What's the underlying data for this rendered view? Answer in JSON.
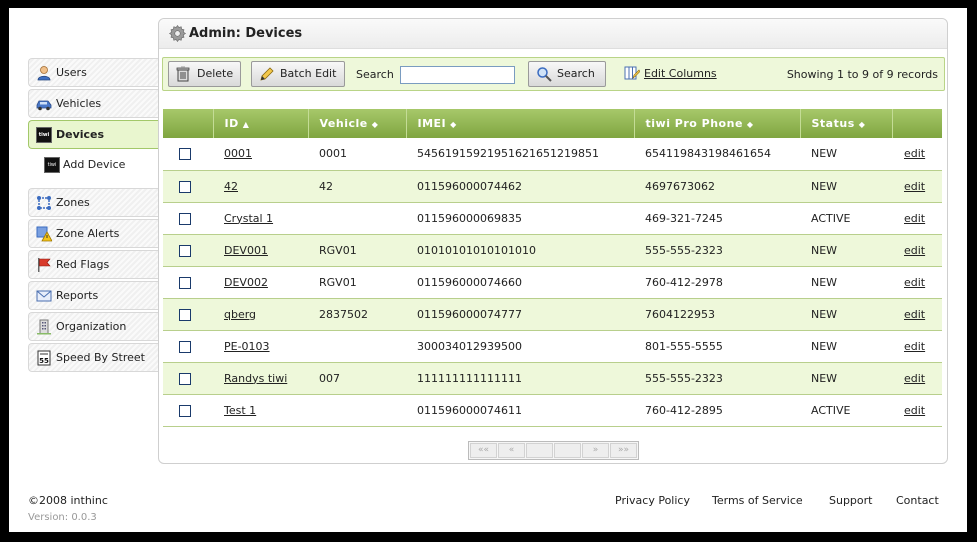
{
  "sidebar": {
    "items": [
      {
        "label": "Users",
        "icon": "user-icon"
      },
      {
        "label": "Vehicles",
        "icon": "vehicle-icon"
      },
      {
        "label": "Devices",
        "icon": "device-icon",
        "active": true
      },
      {
        "label": "Add Device",
        "icon": "device-icon",
        "sub": true
      }
    ],
    "items2": [
      {
        "label": "Zones",
        "icon": "zones-icon"
      },
      {
        "label": "Zone Alerts",
        "icon": "zone-alert-icon"
      },
      {
        "label": "Red Flags",
        "icon": "red-flag-icon"
      },
      {
        "label": "Reports",
        "icon": "reports-icon"
      },
      {
        "label": "Organization",
        "icon": "organization-icon"
      },
      {
        "label": "Speed By Street",
        "icon": "speed-sign-icon"
      }
    ],
    "device_icon_text": "tiwi",
    "speed_icon_text": "55"
  },
  "panel": {
    "title": "Admin: Devices"
  },
  "toolbar": {
    "delete_label": "Delete",
    "batch_edit_label": "Batch Edit",
    "search_label": "Search",
    "search_value": "",
    "search_button_label": "Search",
    "edit_columns_label": "Edit Columns",
    "records_text": "Showing 1 to 9 of 9 records"
  },
  "table": {
    "columns": [
      "ID",
      "Vehicle",
      "IMEI",
      "tiwi Pro Phone",
      "Status"
    ],
    "sort_asc": "▲",
    "sort_both": "◆",
    "edit_label": "edit",
    "rows": [
      {
        "id": "0001",
        "vehicle": "0001",
        "imei": "545619159219516216512198​51",
        "phone": "654119843198461654",
        "status": "NEW"
      },
      {
        "id": "42",
        "vehicle": "42",
        "imei": "011596000074462",
        "phone": "4697673062",
        "status": "NEW"
      },
      {
        "id": "Crystal 1",
        "vehicle": "",
        "imei": "011596000069835",
        "phone": "469-321-7245",
        "status": "ACTIVE"
      },
      {
        "id": "DEV001",
        "vehicle": "RGV01",
        "imei": "01010101010101010",
        "phone": "555-555-2323",
        "status": "NEW"
      },
      {
        "id": "DEV002",
        "vehicle": "RGV01",
        "imei": "011596000074660",
        "phone": "760-412-2978",
        "status": "NEW"
      },
      {
        "id": "qberg",
        "vehicle": "2837502",
        "imei": "011596000074777",
        "phone": "7604122953",
        "status": "NEW"
      },
      {
        "id": "PE-0103",
        "vehicle": "",
        "imei": "300034012939500",
        "phone": "801-555-5555",
        "status": "NEW"
      },
      {
        "id": "Randys tiwi",
        "vehicle": "007",
        "imei": "111111111111111",
        "phone": "555-555-2323",
        "status": "NEW"
      },
      {
        "id": "Test 1",
        "vehicle": "",
        "imei": "011596000074611",
        "phone": "760-412-2895",
        "status": "ACTIVE"
      }
    ]
  },
  "pager": {
    "first": "«‹",
    "prev": "«",
    "page_a": "",
    "page_b": "",
    "next": "»",
    "last": "»»"
  },
  "footer": {
    "copyright": "©2008 inthinc",
    "version": "Version: 0.0.3",
    "privacy": "Privacy Policy",
    "terms": "Terms of Service",
    "support": "Support",
    "contact": "Contact"
  },
  "colors": {
    "accent_green": "#8fb552",
    "row_alt": "#eef8da",
    "active_nav": "#e9f6cf"
  }
}
